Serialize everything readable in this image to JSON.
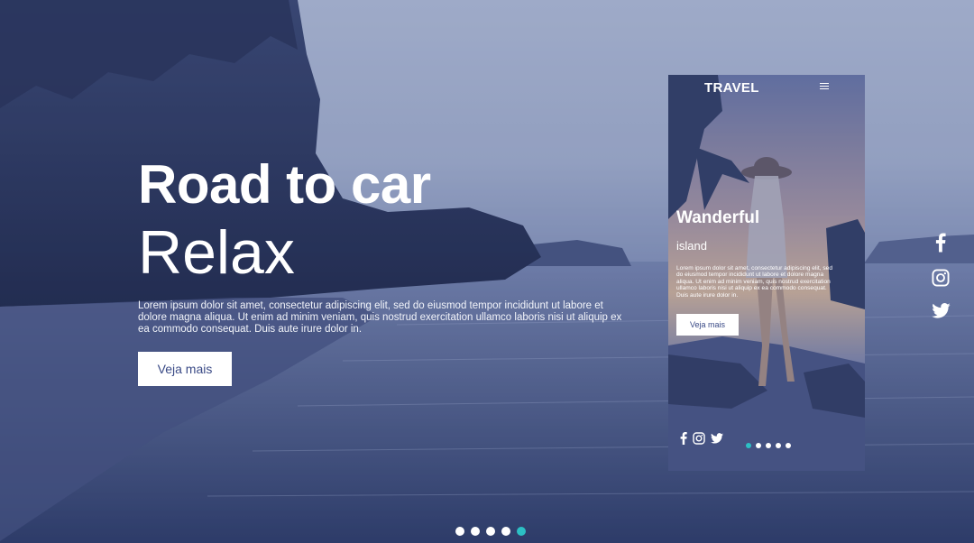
{
  "hero": {
    "title_line1": "Road to car",
    "title_line2": "Relax",
    "text": "Lorem ipsum dolor sit amet, consectetur adipiscing elit, sed do eiusmod tempor incididunt ut labore et dolore magna aliqua. Ut enim ad minim veniam, quis nostrud exercitation ullamco laboris nisi ut aliquip ex ea commodo consequat. Duis aute irure dolor in.",
    "button_label": "Veja mais"
  },
  "phone": {
    "brand": "TRAVEL",
    "menu_icon": "hamburger-icon",
    "title": "Wanderful",
    "subtitle": "island",
    "text": "Lorem ipsum dolor sit amet, consectetur adipiscing elit, sed do eiusmod tempor incididunt ut labore et dolore magna aliqua. Ut enim ad minim veniam, quis nostrud exercitation ullamco laboris nisi ut aliquip ex ea commodo consequat. Duis aute irure dolor in.",
    "button_label": "Veja mais",
    "social_icons": [
      "facebook-icon",
      "instagram-icon",
      "twitter-icon"
    ],
    "dots": {
      "count": 5,
      "active_index": 0
    }
  },
  "social": {
    "icons": [
      "facebook-icon",
      "instagram-icon",
      "twitter-icon"
    ]
  },
  "slider": {
    "count": 5,
    "active_index": 4
  },
  "colors": {
    "accent": "#2cc0c4",
    "button_text": "#3a4a86",
    "overlay": "#4a5a96"
  }
}
